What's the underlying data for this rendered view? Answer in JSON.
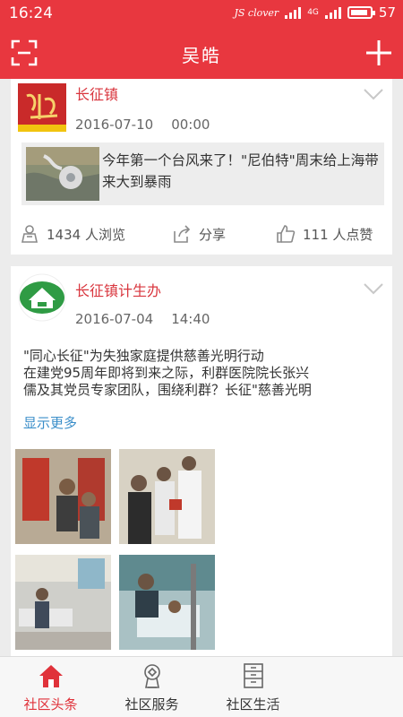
{
  "status": {
    "time": "16:24",
    "carrier": "JS clover",
    "network": "4G",
    "battery": "57"
  },
  "header": {
    "title": "吴皓"
  },
  "feed": [
    {
      "source": "长征镇",
      "date": "2016-07-10",
      "time": "00:00",
      "link_title": "今年第一个台风来了！\"尼伯特\"周末给上海带来大到暴雨",
      "views": "1434 人浏览",
      "share": "分享",
      "likes": "111 人点赞"
    },
    {
      "source": "长征镇计生办",
      "date": "2016-07-04",
      "time": "14:40",
      "text_line1": "\"同心长征\"为失独家庭提供慈善光明行动",
      "text_line2": "在建党95周年即将到来之际，利群医院院长张兴",
      "text_line3": "儒及其党员专家团队，围绕利群？长征\"慈善光明",
      "more": "显示更多"
    }
  ],
  "tabs": [
    {
      "label": "社区头条",
      "active": true
    },
    {
      "label": "社区服务",
      "active": false
    },
    {
      "label": "社区生活",
      "active": false
    }
  ],
  "colors": {
    "brand": "#e8373f",
    "source_text": "#d9363e",
    "link": "#3a8ec9"
  }
}
